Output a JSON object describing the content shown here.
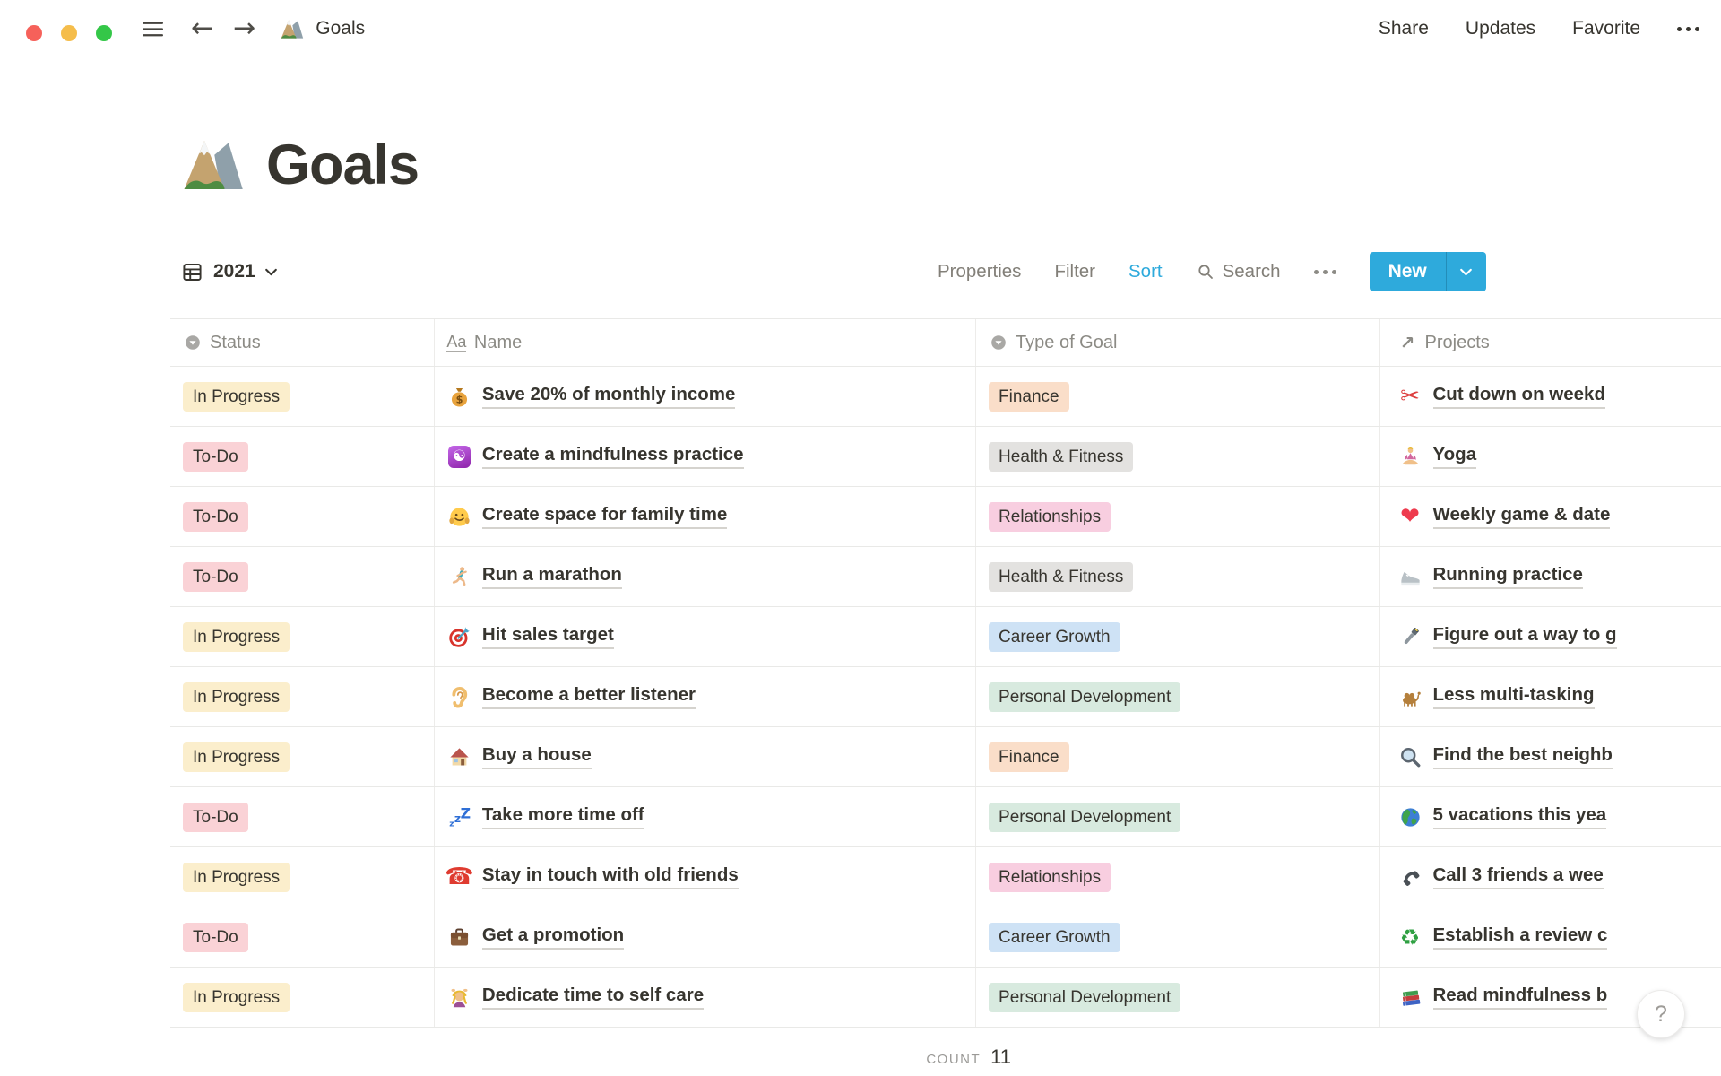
{
  "window": {
    "controls": {
      "close": "#F6615A",
      "minimize": "#F5BD4B",
      "zoom": "#34C748"
    },
    "menu_icon": "hamburger",
    "back_icon": "arrow-left",
    "forward_icon": "arrow-right",
    "doc_icon": "mountain",
    "doc_title": "Goals",
    "menu": [
      "Share",
      "Updates",
      "Favorite"
    ],
    "more_icon": "dots-horizontal"
  },
  "page": {
    "emoji_icon": "mountain",
    "title": "Goals"
  },
  "toolbar": {
    "view_icon": "table-grid",
    "view_label": "2021",
    "view_chevron": "chevron-down",
    "properties": "Properties",
    "filter": "Filter",
    "sort": "Sort",
    "search_icon": "magnifier",
    "search": "Search",
    "more_icon": "dots-horizontal",
    "new_label": "New",
    "new_chevron": "chevron-down"
  },
  "table": {
    "headers": [
      {
        "label": "Status",
        "icon": "select"
      },
      {
        "label": "Name",
        "icon": "text"
      },
      {
        "label": "Type of Goal",
        "icon": "select"
      },
      {
        "label": "Projects",
        "icon": "relation"
      }
    ],
    "rows": [
      {
        "status": "In Progress",
        "status_color": "yellow",
        "name_icon": "money-bag",
        "name": "Save 20% of monthly income",
        "type": "Finance",
        "type_color": "orange",
        "project_icon": "scissors",
        "project": "Cut down on weekd"
      },
      {
        "status": "To-Do",
        "status_color": "red",
        "name_icon": "yin-yang",
        "name": "Create a mindfulness practice",
        "type": "Health & Fitness",
        "type_color": "gray",
        "project_icon": "lotus",
        "project": "Yoga"
      },
      {
        "status": "To-Do",
        "status_color": "red",
        "name_icon": "hugging-face",
        "name": "Create space for family time",
        "type": "Relationships",
        "type_color": "pink",
        "project_icon": "heart",
        "project": "Weekly game & date"
      },
      {
        "status": "To-Do",
        "status_color": "red",
        "name_icon": "runner",
        "name": "Run a marathon",
        "type": "Health & Fitness",
        "type_color": "gray",
        "project_icon": "sneaker",
        "project": "Running practice"
      },
      {
        "status": "In Progress",
        "status_color": "yellow",
        "name_icon": "target",
        "name": "Hit sales target",
        "type": "Career Growth",
        "type_color": "blue",
        "project_icon": "flashlight",
        "project": "Figure out a way to g"
      },
      {
        "status": "In Progress",
        "status_color": "yellow",
        "name_icon": "ear",
        "name": "Become a better listener",
        "type": "Personal Development",
        "type_color": "green",
        "project_icon": "camel",
        "project": "Less multi-tasking"
      },
      {
        "status": "In Progress",
        "status_color": "yellow",
        "name_icon": "house",
        "name": "Buy a house",
        "type": "Finance",
        "type_color": "orange",
        "project_icon": "magnifying-glass",
        "project": "Find the best neighb"
      },
      {
        "status": "To-Do",
        "status_color": "red",
        "name_icon": "zzz",
        "name": "Take more time off",
        "type": "Personal Development",
        "type_color": "green",
        "project_icon": "globe",
        "project": "5 vacations this yea"
      },
      {
        "status": "In Progress",
        "status_color": "yellow",
        "name_icon": "classic-phone",
        "name": "Stay in touch with old friends",
        "type": "Relationships",
        "type_color": "pink",
        "project_icon": "phone-receiver",
        "project": "Call 3 friends a wee"
      },
      {
        "status": "To-Do",
        "status_color": "red",
        "name_icon": "briefcase",
        "name": "Get a promotion",
        "type": "Career Growth",
        "type_color": "blue",
        "project_icon": "recycle",
        "project": "Establish a review c"
      },
      {
        "status": "In Progress",
        "status_color": "yellow",
        "name_icon": "massage",
        "name": "Dedicate time to self care",
        "type": "Personal Development",
        "type_color": "green",
        "project_icon": "books",
        "project": "Read mindfulness b"
      }
    ],
    "footer": {
      "count_label": "COUNT",
      "count_value": "11"
    }
  },
  "help": {
    "label": "?"
  },
  "colors": {
    "accent": "#2EAADC",
    "tags": {
      "yellow": "#FBEECC",
      "red": "#FAD2D6",
      "orange": "#FADEC9",
      "gray": "#E3E2E0",
      "pink": "#F8CEE0",
      "blue": "#CEE2F5",
      "green": "#D8EADF"
    }
  }
}
